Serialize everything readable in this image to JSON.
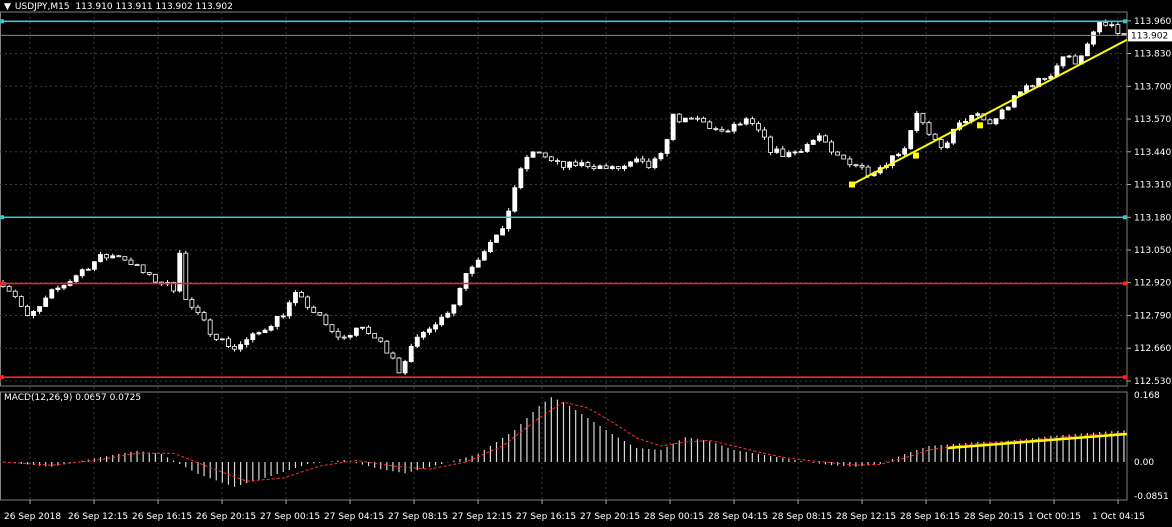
{
  "header": {
    "symbol_label": "USDJPY,M15",
    "ohlc": "113.910 113.911 113.902 113.902"
  },
  "macd_header": {
    "label": "MACD(12,26,9)",
    "values": "0.0657 0.0725"
  },
  "colors": {
    "background": "#000000",
    "grid": "#3a3a3a",
    "bull_candle": "#ffffff",
    "bear_candle": "#000000",
    "accent_cyan": "#38c6c6",
    "accent_red": "#ff2020",
    "trend_yellow": "#ffff00",
    "signal_red": "#ff3030"
  },
  "chart_data": {
    "type": "candlestick",
    "symbol": "USDJPY",
    "timeframe": "M15",
    "price_ticks": [
      "113.960",
      "113.830",
      "113.700",
      "113.570",
      "113.440",
      "113.310",
      "113.180",
      "113.050",
      "112.920",
      "112.790",
      "112.660",
      "112.530"
    ],
    "price_range": [
      112.51,
      113.995
    ],
    "current_price": "113.902",
    "time_ticks": [
      "26 Sep 2018",
      "26 Sep 12:15",
      "26 Sep 16:15",
      "26 Sep 20:15",
      "27 Sep 00:15",
      "27 Sep 04:15",
      "27 Sep 08:15",
      "27 Sep 12:15",
      "27 Sep 16:15",
      "27 Sep 20:15",
      "28 Sep 00:15",
      "28 Sep 04:15",
      "28 Sep 08:15",
      "28 Sep 12:15",
      "28 Sep 16:15",
      "28 Sep 20:15",
      "1 Oct 00:15",
      "1 Oct 04:15"
    ],
    "horizontal_levels": [
      {
        "price": 113.958,
        "color": "#38c6c6"
      },
      {
        "price": 113.18,
        "color": "#38c6c6"
      },
      {
        "price": 112.917,
        "color": "#ff2020"
      },
      {
        "price": 112.545,
        "color": "#ff2020"
      }
    ],
    "trendline": {
      "from": {
        "time": "28 Sep 14:00",
        "price": 113.31
      },
      "to": {
        "time": "1 Oct 05:00",
        "price": 113.885
      }
    },
    "anchors": [
      {
        "time": "28 Sep 18:00",
        "price": 113.425
      },
      {
        "time": "28 Sep 22:00",
        "price": 113.545
      }
    ],
    "close_path": [
      [
        0,
        112.92
      ],
      [
        2,
        112.87
      ],
      [
        4,
        112.78
      ],
      [
        6,
        112.82
      ],
      [
        8,
        112.88
      ],
      [
        11,
        112.93
      ],
      [
        13,
        112.97
      ],
      [
        16,
        113.02
      ],
      [
        19,
        113.03
      ],
      [
        21,
        113.0
      ],
      [
        24,
        112.94
      ],
      [
        26,
        112.92
      ],
      [
        28,
        112.9
      ],
      [
        29,
        113.05
      ],
      [
        30,
        112.85
      ],
      [
        32,
        112.79
      ],
      [
        34,
        112.73
      ],
      [
        36,
        112.69
      ],
      [
        38,
        112.66
      ],
      [
        40,
        112.69
      ],
      [
        42,
        112.72
      ],
      [
        44,
        112.76
      ],
      [
        46,
        112.8
      ],
      [
        48,
        112.87
      ],
      [
        50,
        112.83
      ],
      [
        52,
        112.78
      ],
      [
        54,
        112.72
      ],
      [
        56,
        112.7
      ],
      [
        58,
        112.74
      ],
      [
        60,
        112.72
      ],
      [
        62,
        112.68
      ],
      [
        64,
        112.63
      ],
      [
        65,
        112.57
      ],
      [
        66,
        112.62
      ],
      [
        68,
        112.69
      ],
      [
        70,
        112.75
      ],
      [
        72,
        112.78
      ],
      [
        74,
        112.84
      ],
      [
        76,
        112.96
      ],
      [
        78,
        113.02
      ],
      [
        80,
        113.09
      ],
      [
        82,
        113.12
      ],
      [
        84,
        113.3
      ],
      [
        86,
        113.42
      ],
      [
        88,
        113.44
      ],
      [
        90,
        113.4
      ],
      [
        92,
        113.38
      ],
      [
        94,
        113.39
      ],
      [
        96,
        113.39
      ],
      [
        98,
        113.38
      ],
      [
        100,
        113.37
      ],
      [
        102,
        113.38
      ],
      [
        104,
        113.4
      ],
      [
        106,
        113.38
      ],
      [
        108,
        113.42
      ],
      [
        110,
        113.58
      ],
      [
        112,
        113.56
      ],
      [
        114,
        113.57
      ],
      [
        116,
        113.54
      ],
      [
        118,
        113.51
      ],
      [
        120,
        113.54
      ],
      [
        122,
        113.56
      ],
      [
        124,
        113.52
      ],
      [
        126,
        113.45
      ],
      [
        128,
        113.43
      ],
      [
        130,
        113.44
      ],
      [
        132,
        113.47
      ],
      [
        134,
        113.5
      ],
      [
        136,
        113.43
      ],
      [
        138,
        113.41
      ],
      [
        140,
        113.39
      ],
      [
        142,
        113.36
      ],
      [
        144,
        113.38
      ],
      [
        146,
        113.42
      ],
      [
        148,
        113.46
      ],
      [
        150,
        113.6
      ],
      [
        152,
        113.5
      ],
      [
        154,
        113.45
      ],
      [
        156,
        113.52
      ],
      [
        158,
        113.57
      ],
      [
        160,
        113.58
      ],
      [
        162,
        113.55
      ],
      [
        164,
        113.6
      ],
      [
        166,
        113.65
      ],
      [
        168,
        113.7
      ],
      [
        170,
        113.72
      ],
      [
        172,
        113.75
      ],
      [
        174,
        113.82
      ],
      [
        176,
        113.8
      ],
      [
        178,
        113.86
      ],
      [
        180,
        113.95
      ],
      [
        182,
        113.93
      ],
      [
        184,
        113.9
      ]
    ],
    "macd": {
      "ticks": [
        "0.168",
        "0.00",
        "-0.0851"
      ],
      "range": [
        -0.095,
        0.175
      ],
      "histogram_path": [
        [
          0,
          0.0
        ],
        [
          8,
          -0.012
        ],
        [
          16,
          0.012
        ],
        [
          22,
          0.028
        ],
        [
          26,
          0.02
        ],
        [
          32,
          -0.03
        ],
        [
          38,
          -0.062
        ],
        [
          44,
          -0.035
        ],
        [
          50,
          -0.005
        ],
        [
          56,
          0.005
        ],
        [
          62,
          -0.018
        ],
        [
          66,
          -0.028
        ],
        [
          72,
          -0.005
        ],
        [
          78,
          0.02
        ],
        [
          84,
          0.08
        ],
        [
          88,
          0.14
        ],
        [
          90,
          0.162
        ],
        [
          92,
          0.15
        ],
        [
          96,
          0.11
        ],
        [
          100,
          0.07
        ],
        [
          104,
          0.035
        ],
        [
          108,
          0.03
        ],
        [
          112,
          0.062
        ],
        [
          116,
          0.052
        ],
        [
          120,
          0.03
        ],
        [
          124,
          0.02
        ],
        [
          128,
          0.01
        ],
        [
          132,
          0.0
        ],
        [
          136,
          -0.008
        ],
        [
          140,
          -0.012
        ],
        [
          144,
          -0.005
        ],
        [
          148,
          0.02
        ],
        [
          152,
          0.04
        ],
        [
          156,
          0.045
        ],
        [
          160,
          0.05
        ],
        [
          164,
          0.052
        ],
        [
          168,
          0.058
        ],
        [
          172,
          0.065
        ],
        [
          176,
          0.07
        ],
        [
          180,
          0.075
        ],
        [
          184,
          0.079
        ]
      ],
      "signal_path": [
        [
          0,
          0.0
        ],
        [
          8,
          -0.008
        ],
        [
          16,
          0.006
        ],
        [
          22,
          0.022
        ],
        [
          28,
          0.022
        ],
        [
          34,
          -0.014
        ],
        [
          40,
          -0.048
        ],
        [
          46,
          -0.04
        ],
        [
          52,
          -0.01
        ],
        [
          58,
          0.004
        ],
        [
          64,
          -0.01
        ],
        [
          70,
          -0.018
        ],
        [
          76,
          0.0
        ],
        [
          82,
          0.04
        ],
        [
          88,
          0.11
        ],
        [
          92,
          0.15
        ],
        [
          96,
          0.135
        ],
        [
          100,
          0.1
        ],
        [
          104,
          0.06
        ],
        [
          108,
          0.04
        ],
        [
          112,
          0.05
        ],
        [
          116,
          0.054
        ],
        [
          120,
          0.04
        ],
        [
          124,
          0.025
        ],
        [
          128,
          0.012
        ],
        [
          132,
          0.004
        ],
        [
          136,
          -0.002
        ],
        [
          140,
          -0.008
        ],
        [
          144,
          -0.006
        ],
        [
          148,
          0.01
        ],
        [
          152,
          0.03
        ],
        [
          156,
          0.04
        ],
        [
          160,
          0.046
        ],
        [
          164,
          0.05
        ],
        [
          168,
          0.054
        ],
        [
          172,
          0.06
        ],
        [
          176,
          0.065
        ],
        [
          180,
          0.07
        ],
        [
          184,
          0.0725
        ]
      ],
      "trendline": {
        "from": {
          "time": "28 Sep 20:00",
          "value": 0.035
        },
        "to": {
          "time": "1 Oct 05:00",
          "value": 0.07
        }
      }
    }
  }
}
